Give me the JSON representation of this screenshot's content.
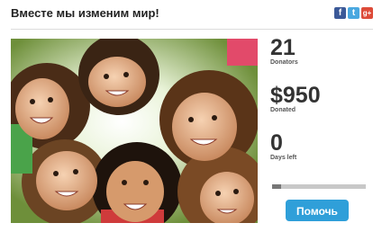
{
  "header": {
    "title": "Вместе мы изменим мир!",
    "share_icons": [
      {
        "icon": "facebook-icon",
        "glyph": "f",
        "color": "#3b5998"
      },
      {
        "icon": "twitter-icon",
        "glyph": "t",
        "color": "#4aa8e0"
      },
      {
        "icon": "google-plus-icon",
        "glyph": "g+",
        "color": "#dd4b39"
      }
    ]
  },
  "campaign": {
    "stats": [
      {
        "value": "21",
        "label": "Donators"
      },
      {
        "value": "$950",
        "label": "Donated"
      },
      {
        "value": "0",
        "label": "Days left"
      }
    ],
    "progress_fraction": 0.1,
    "help_button_label": "Помочь"
  },
  "colors": {
    "accent": "#2f9fd9",
    "progress_track": "#c8c8c8",
    "progress_fill": "#777777"
  }
}
